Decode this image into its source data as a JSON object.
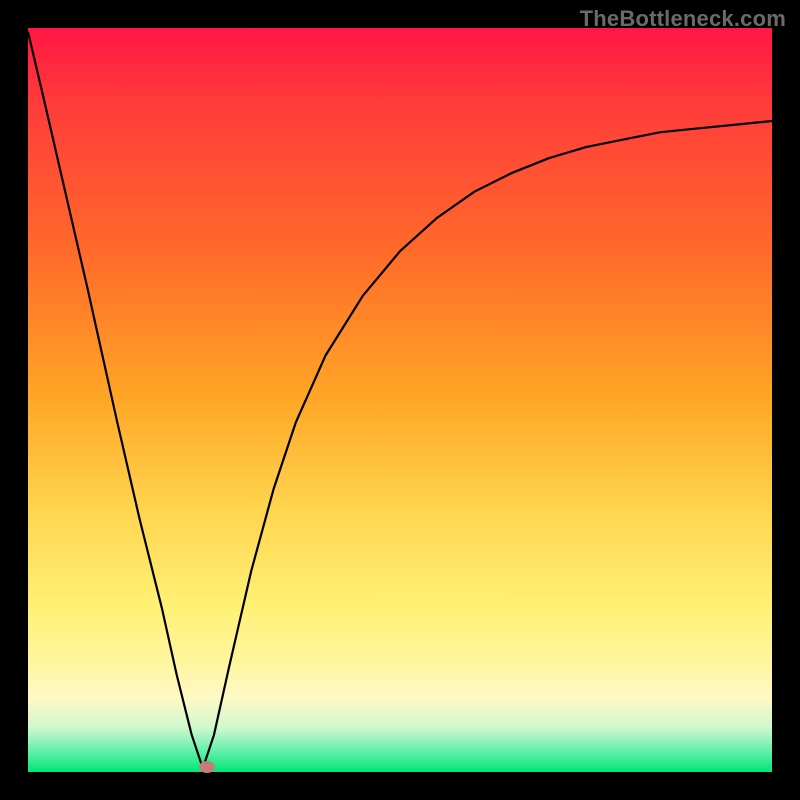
{
  "attribution": "TheBottleneck.com",
  "colors": {
    "background": "#000000",
    "gradient_top": "#ff1744",
    "gradient_bottom": "#00e676",
    "curve": "#000000",
    "marker": "#c77b7b"
  },
  "chart_data": {
    "type": "line",
    "title": "",
    "xlabel": "",
    "ylabel": "",
    "xlim": [
      0,
      100
    ],
    "ylim": [
      0,
      100
    ],
    "x": [
      0,
      2,
      5,
      8,
      10,
      12,
      15,
      18,
      20,
      22,
      23.5,
      25,
      27,
      30,
      33,
      36,
      40,
      45,
      50,
      55,
      60,
      65,
      70,
      75,
      80,
      85,
      90,
      95,
      100
    ],
    "values": [
      99.5,
      91,
      78,
      65,
      56,
      47,
      34,
      22,
      13,
      5,
      0.5,
      5,
      14,
      27,
      38,
      47,
      56,
      64,
      70,
      74.5,
      78,
      80.5,
      82.5,
      84,
      85,
      86,
      86.5,
      87,
      87.5
    ],
    "marker": {
      "x": 24,
      "y": 0.7
    }
  }
}
